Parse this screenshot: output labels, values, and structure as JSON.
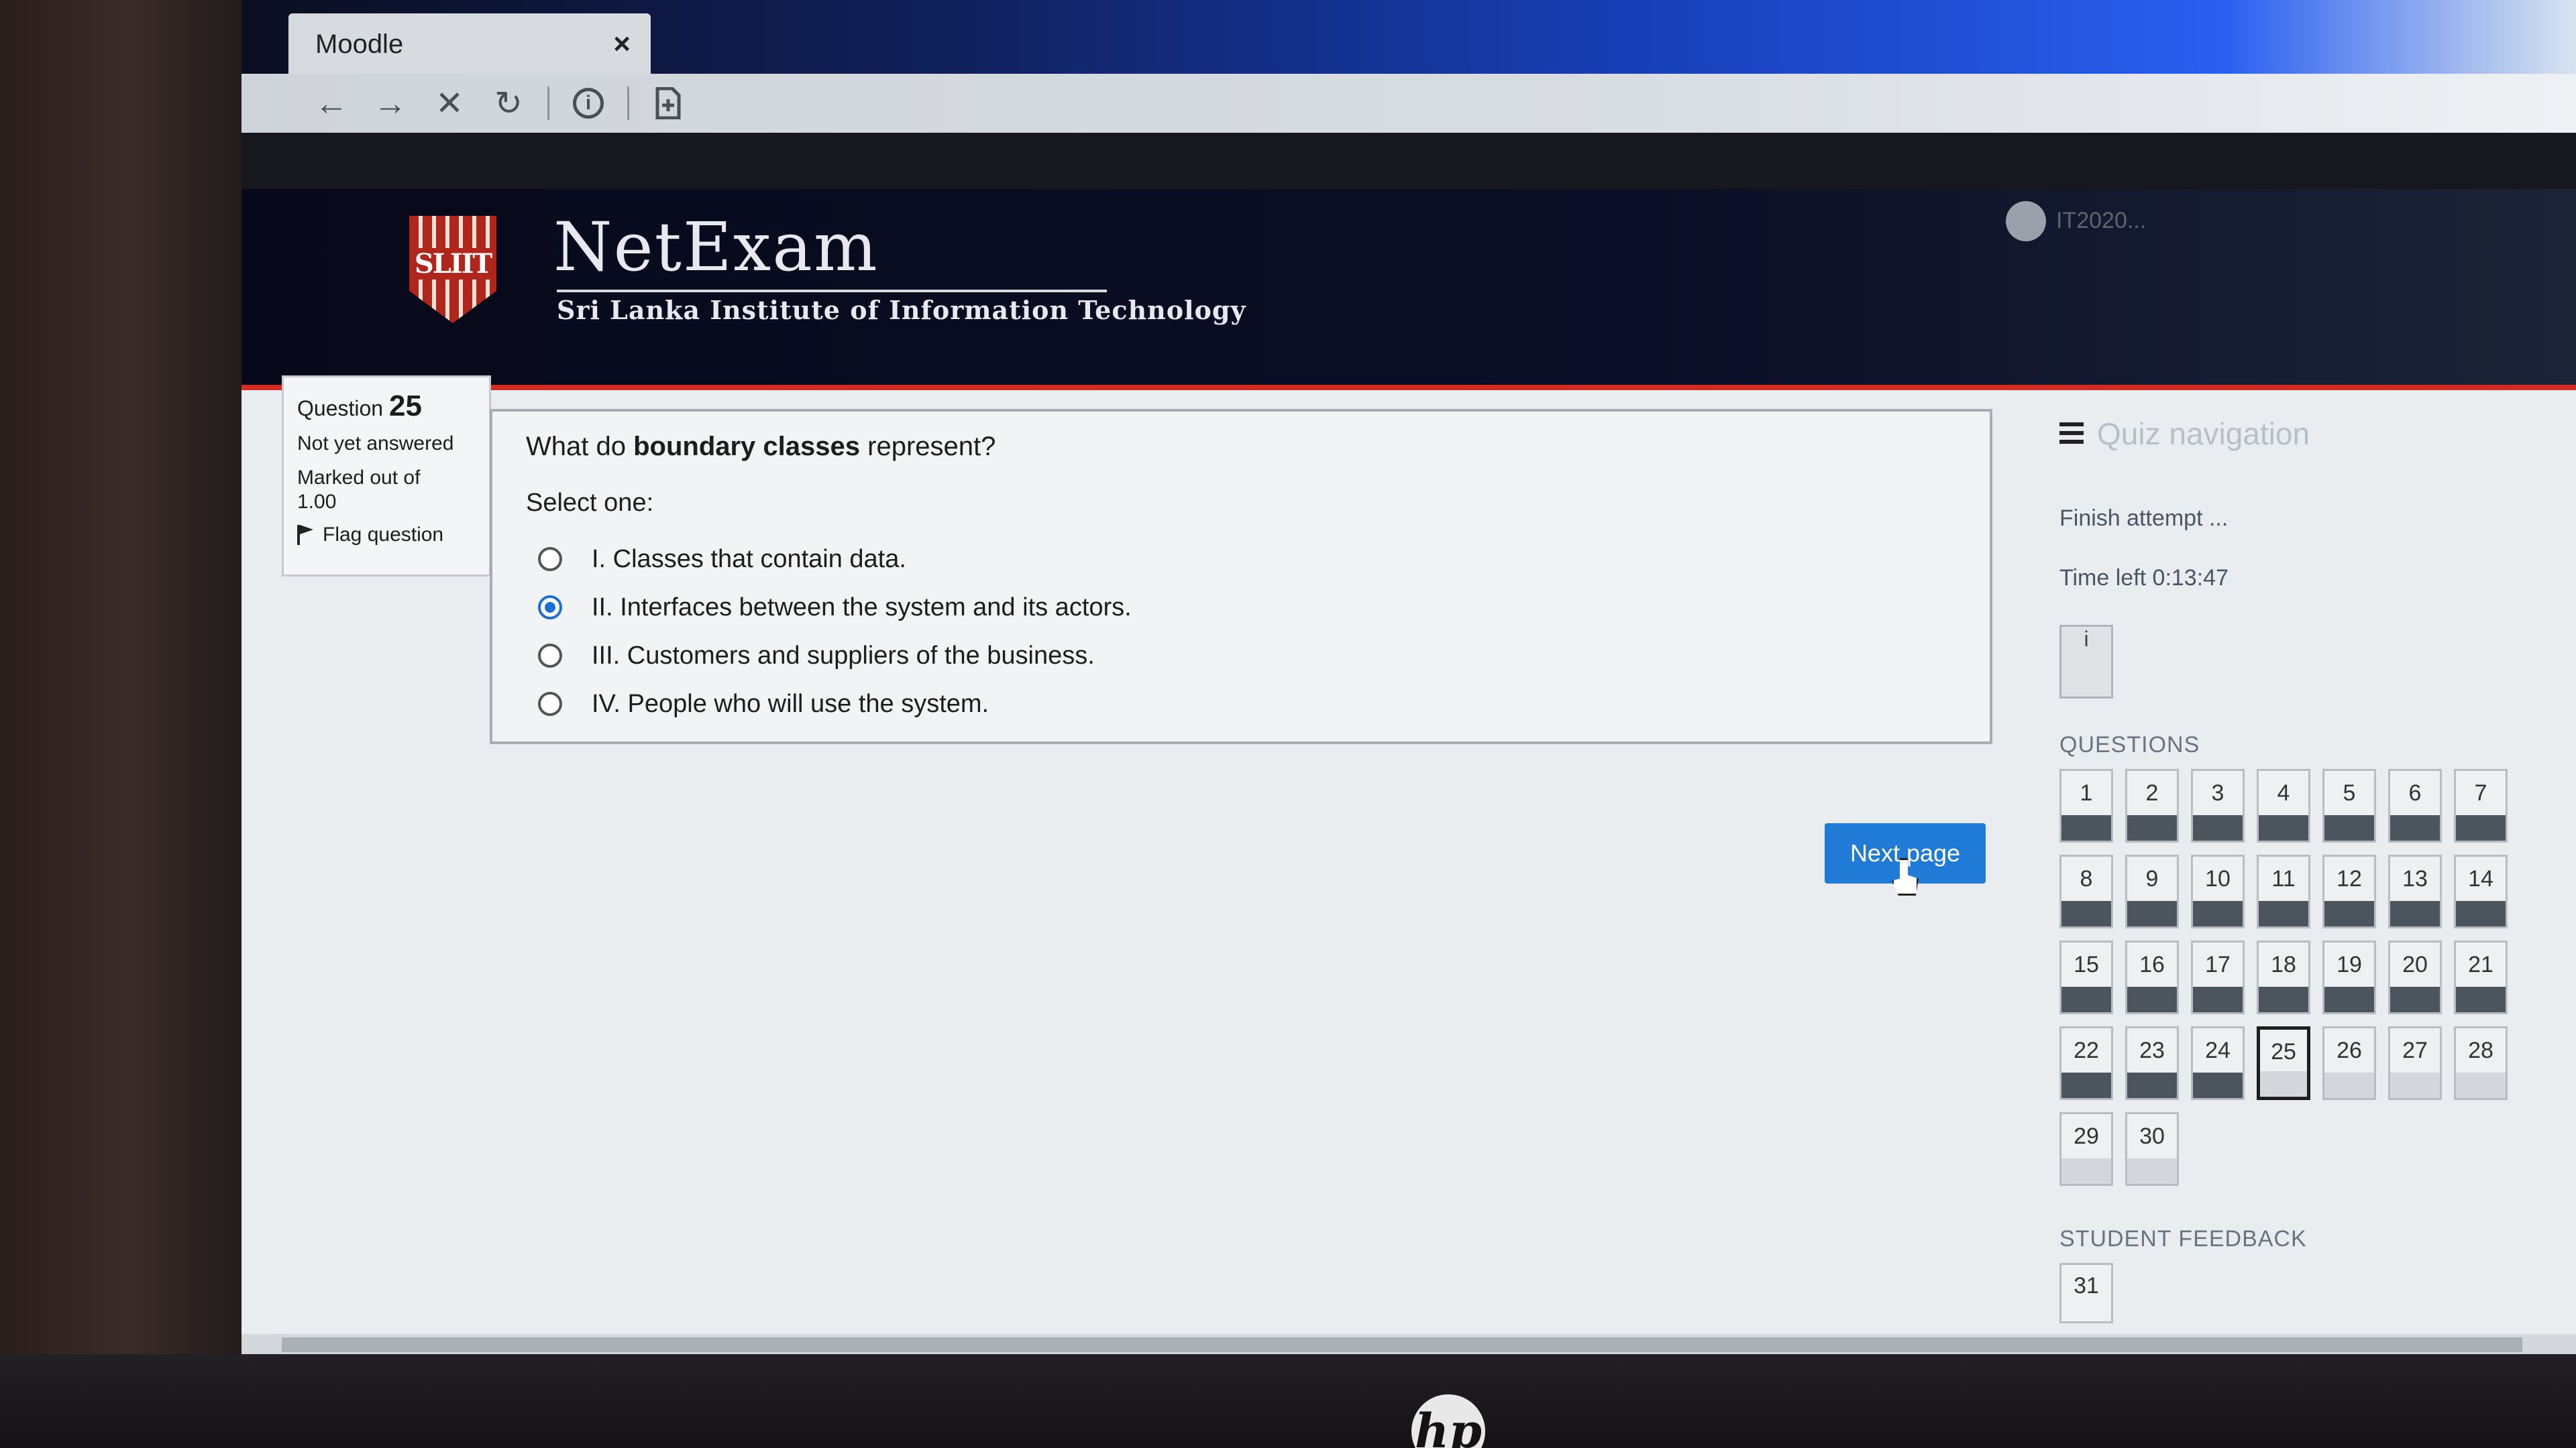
{
  "browser": {
    "tab_title": "Moodle",
    "tab_close": "×",
    "nav_back": "←",
    "nav_forward": "→",
    "nav_stop": "✕",
    "nav_reload": "↻",
    "info": "i"
  },
  "header": {
    "logo_text": "SLIIT",
    "brand_title": "NetExam",
    "brand_subtitle": "Sri Lanka Institute of Information Technology",
    "username": "IT2020..."
  },
  "question_info": {
    "label": "Question",
    "number": "25",
    "state": "Not yet answered",
    "marked_out_of": "Marked out of",
    "marks": "1.00",
    "flag_label": "Flag question"
  },
  "question": {
    "text_before": "What do ",
    "text_bold": "boundary classes",
    "text_after": " represent?",
    "select_one": "Select one:",
    "options": [
      {
        "label": "I. Classes that contain data.",
        "selected": false
      },
      {
        "label": "II. Interfaces between the system and its actors.",
        "selected": true
      },
      {
        "label": "III. Customers and suppliers of the business.",
        "selected": false
      },
      {
        "label": "IV. People who will use the system.",
        "selected": false
      }
    ]
  },
  "next_page_label": "Next page",
  "quiz_nav": {
    "title": "Quiz navigation",
    "finish_attempt": "Finish attempt ...",
    "time_left": "Time left 0:13:47",
    "timer_cell": "i",
    "questions_heading": "QUESTIONS",
    "questions": [
      [
        "1",
        "answered"
      ],
      [
        "2",
        "answered"
      ],
      [
        "3",
        "answered"
      ],
      [
        "4",
        "answered"
      ],
      [
        "5",
        "answered"
      ],
      [
        "6",
        "answered"
      ],
      [
        "7",
        "answered"
      ],
      [
        "8",
        "answered"
      ],
      [
        "9",
        "answered"
      ],
      [
        "10",
        "answered"
      ],
      [
        "11",
        "answered"
      ],
      [
        "12",
        "answered"
      ],
      [
        "13",
        "answered"
      ],
      [
        "14",
        "answered"
      ],
      [
        "15",
        "answered"
      ],
      [
        "16",
        "answered"
      ],
      [
        "17",
        "answered"
      ],
      [
        "18",
        "answered"
      ],
      [
        "19",
        "answered"
      ],
      [
        "20",
        "answered"
      ],
      [
        "21",
        "answered"
      ],
      [
        "22",
        "answered"
      ],
      [
        "23",
        "answered"
      ],
      [
        "24",
        "answered"
      ],
      [
        "25",
        "current"
      ],
      [
        "26",
        "open"
      ],
      [
        "27",
        "open"
      ],
      [
        "28",
        "open"
      ],
      [
        "29",
        "open"
      ],
      [
        "30",
        "open"
      ]
    ],
    "feedback_heading": "STUDENT FEEDBACK",
    "feedback_item": "31"
  }
}
